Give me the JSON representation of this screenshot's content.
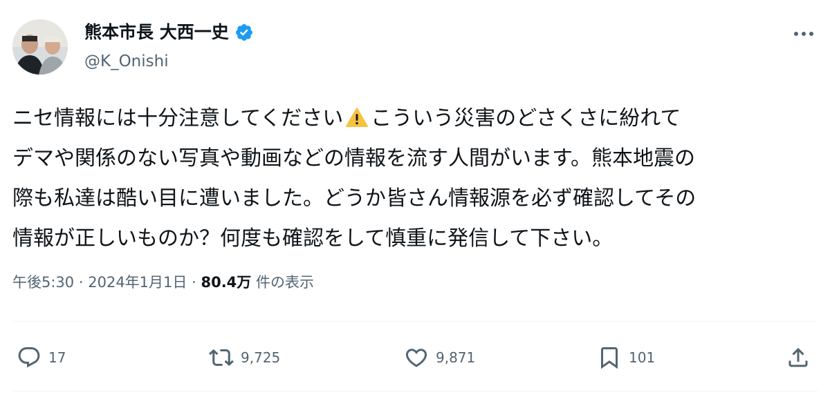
{
  "author": {
    "display_name": "熊本市長 大西一史",
    "handle": "@K_Onishi",
    "verified": true,
    "verified_color": "#1d9bf0"
  },
  "tweet": {
    "lines": [
      [
        "ニセ情報には十分注意してください",
        "こういう災害のどさくさに紛れて"
      ],
      "デマや関係のない写真や動画などの情報を流す人間がいます。熊本地震の",
      "際も私達は酷い目に遭いました。どうか皆さん情報源を必ず確認してその",
      "情報が正しいものか？何度も確認をして慎重に発信して下さい。"
    ],
    "emoji": "warning-icon"
  },
  "meta": {
    "time": "午後5:30",
    "separator": "·",
    "date": "2024年1月1日",
    "views_count": "80.4万",
    "views_label": "件の表示"
  },
  "actions": {
    "replies": "17",
    "retweets": "9,725",
    "likes": "9,871",
    "bookmarks": "101"
  },
  "colors": {
    "text": "#0f1419",
    "secondary": "#536471",
    "warning": "#f5c242"
  }
}
